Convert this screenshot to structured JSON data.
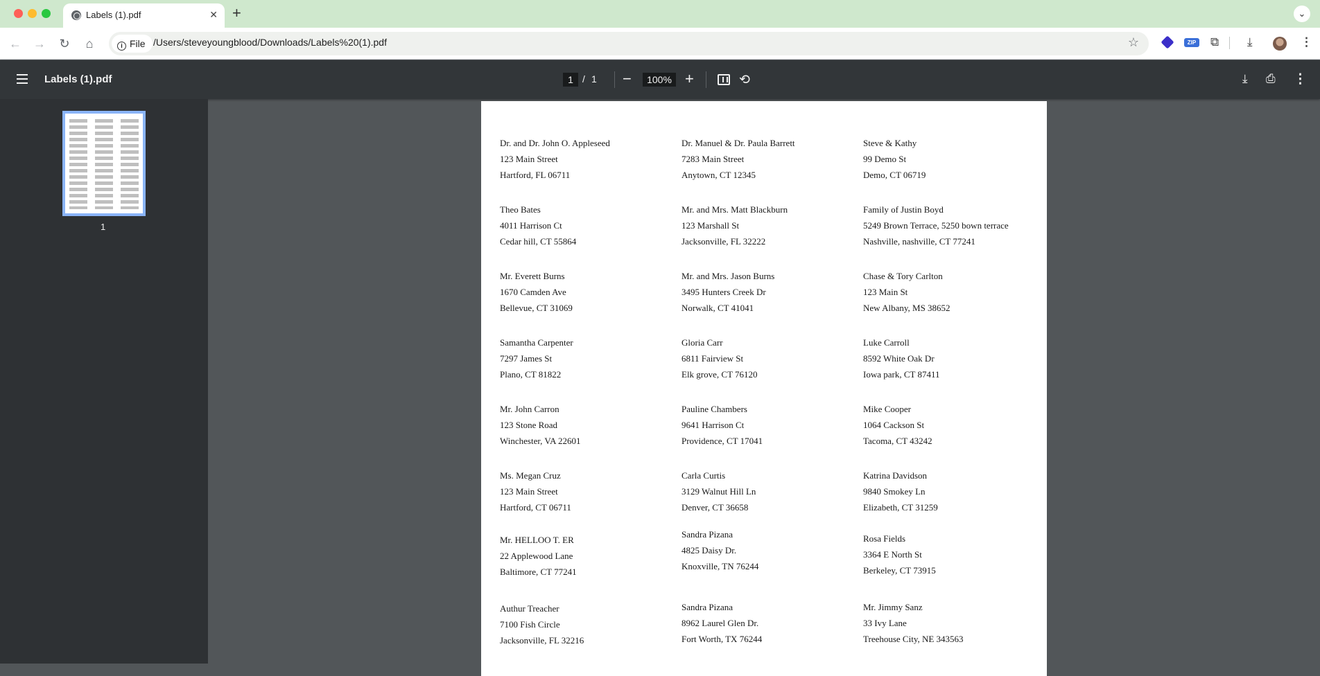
{
  "browser": {
    "tab_title": "Labels (1).pdf",
    "omnibox_chip": "File",
    "url": "/Users/steveyoungblood/Downloads/Labels%20(1).pdf",
    "extensions": [
      "layers-icon",
      "zip-icon",
      "puzzle-icon"
    ],
    "zip_label": "ZIP"
  },
  "viewer": {
    "doc_title": "Labels (1).pdf",
    "current_page": "1",
    "page_separator": "/",
    "total_pages": "1",
    "zoom": "100%",
    "thumbnail_number": "1"
  },
  "labels": [
    {
      "name": "Dr. and Dr. John O. Appleseed",
      "street": "123 Main Street",
      "city": "Hartford, FL  06711"
    },
    {
      "name": "Dr. Manuel & Dr. Paula Barrett",
      "street": "7283 Main Street",
      "city": "Anytown, CT  12345"
    },
    {
      "name": "Steve & Kathy",
      "street": "99 Demo St",
      "city": "Demo, CT  06719"
    },
    {
      "name": "Theo Bates",
      "street": "4011 Harrison Ct",
      "city": "Cedar hill, CT  55864"
    },
    {
      "name": "Mr. and Mrs. Matt Blackburn",
      "street": "123 Marshall St",
      "city": "Jacksonville, FL  32222"
    },
    {
      "name": "Family of Justin Boyd",
      "street": "5249 Brown Terrace, 5250 bown terrace",
      "city": "Nashville, nashville, CT  77241"
    },
    {
      "name": "Mr. Everett Burns",
      "street": "1670 Camden Ave",
      "city": "Bellevue, CT  31069"
    },
    {
      "name": "Mr. and Mrs. Jason Burns",
      "street": "3495 Hunters Creek Dr",
      "city": "Norwalk, CT  41041"
    },
    {
      "name": "Chase & Tory Carlton",
      "street": "123 Main St",
      "city": "New Albany, MS  38652"
    },
    {
      "name": "Samantha Carpenter",
      "street": "7297 James St",
      "city": "Plano, CT  81822"
    },
    {
      "name": "Gloria Carr",
      "street": "6811 Fairview St",
      "city": "Elk grove, CT  76120"
    },
    {
      "name": "Luke Carroll",
      "street": "8592 White Oak Dr",
      "city": "Iowa park, CT  87411"
    },
    {
      "name": "Mr. John Carron",
      "street": "123 Stone Road",
      "city": "Winchester, VA  22601"
    },
    {
      "name": "Pauline Chambers",
      "street": "9641 Harrison Ct",
      "city": "Providence, CT  17041"
    },
    {
      "name": "Mike Cooper",
      "street": "1064 Cackson St",
      "city": "Tacoma, CT  43242"
    },
    {
      "name": "Ms. Megan Cruz",
      "street": "123 Main Street",
      "city": "Hartford, CT  06711"
    },
    {
      "name": "Carla Curtis",
      "street": "3129 Walnut Hill Ln",
      "city": "Denver, CT  36658"
    },
    {
      "name": "Katrina Davidson",
      "street": "9840 Smokey Ln",
      "city": "Elizabeth, CT  31259"
    },
    {
      "name": "Mr. HELLOO T. ER",
      "street": "22 Applewood Lane",
      "city": "Baltimore, CT  77241"
    },
    {
      "name": "Sandra Pizana",
      "street": "4825 Daisy Dr.",
      "city": "Knoxville, TN  76244"
    },
    {
      "name": "Rosa Fields",
      "street": "3364 E North St",
      "city": "Berkeley, CT  73915"
    },
    {
      "name": "Authur Treacher",
      "street": "7100 Fish Circle",
      "city": "Jacksonville, FL  32216"
    },
    {
      "name": "Sandra Pizana",
      "street": "8962 Laurel Glen Dr.",
      "city": "Fort Worth, TX  76244"
    },
    {
      "name": "Mr. Jimmy Sanz",
      "street": "33 Ivy Lane",
      "city": "Treehouse City, NE  343563"
    }
  ]
}
